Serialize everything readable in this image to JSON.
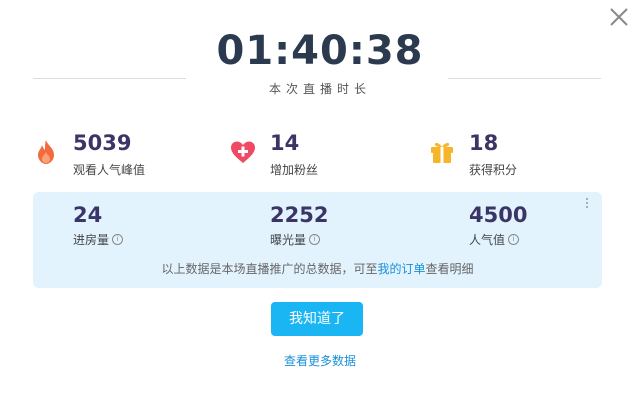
{
  "timer": {
    "value": "01:40:38",
    "label": "本次直播时长"
  },
  "stats": [
    {
      "icon": "flame-icon",
      "value": "5039",
      "label": "观看人气峰值",
      "color": "#f26a3d"
    },
    {
      "icon": "heart-plus-icon",
      "value": "14",
      "label": "增加粉丝",
      "color": "#ef4a64"
    },
    {
      "icon": "gift-icon",
      "value": "18",
      "label": "获得积分",
      "color": "#f6b52a"
    }
  ],
  "promo": {
    "items": [
      {
        "value": "24",
        "label": "进房量"
      },
      {
        "value": "2252",
        "label": "曝光量"
      },
      {
        "value": "4500",
        "label": "人气值"
      }
    ],
    "note_prefix": "以上数据是本场直播推广的总数据，可至",
    "note_link": "我的订单",
    "note_suffix": "查看明细"
  },
  "confirm_button": "我知道了",
  "more_link": "查看更多数据",
  "colors": {
    "accent": "#1ab5f3",
    "panel": "#e2f3fe",
    "number": "#3a3566"
  }
}
